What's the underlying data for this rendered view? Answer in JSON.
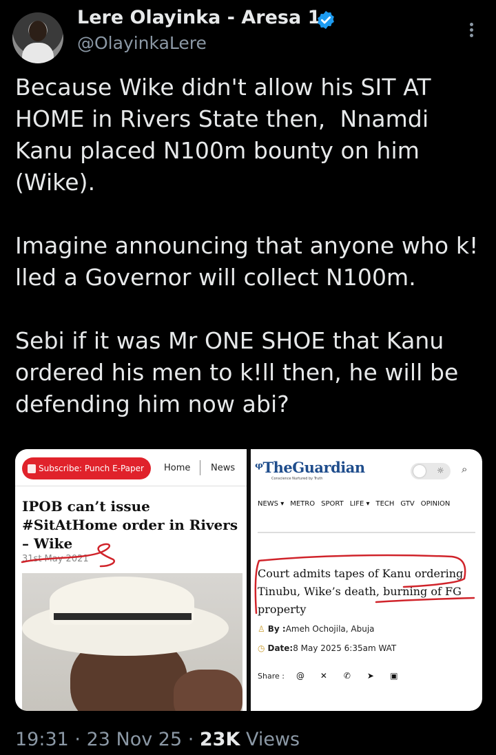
{
  "author": {
    "display_name": "Lere Olayinka - Aresa 1",
    "handle": "@OlayinkaLere",
    "verified_color": "#1d9bf0",
    "avatar_icon": "profile-photo"
  },
  "tweet": {
    "text": "Because Wike didn't allow his SIT AT\nHOME in Rivers State then,  Nnamdi\nKanu placed N100m bounty on him\n(Wike).\n\nImagine announcing that anyone who k!\nlled a Governor will collect N100m.\n\nSebi if it was Mr ONE SHOE that Kanu\nordered his men to k!ll then, he will be\ndefending him now abi?"
  },
  "media": {
    "punch": {
      "subscribe_label": "Subscribe: Punch E-Paper",
      "nav_home": "Home",
      "nav_news": "News",
      "headline": "IPOB can’t issue #SitAtHome order in Rivers – Wike",
      "date": "31st May 2021",
      "accent_color": "#e0222b"
    },
    "guardian": {
      "logo": "TheGuardian",
      "tagline": "Conscience Nurtured by Truth",
      "nav": [
        "NEWS ▾",
        "METRO",
        "SPORT",
        "LIFE ▾",
        "TECH",
        "GTV",
        "OPINION"
      ],
      "headline": "Court admits tapes of Kanu ordering Tinubu, Wike’s death, burning of FG property",
      "by_label": "By :",
      "by_value": "Ameh Ochojila, Abuja",
      "date_label": "Date:",
      "date_value": "8 May 2025 6:35am WAT",
      "share_label": "Share :",
      "share_icons": [
        "threads-icon",
        "x-icon",
        "whatsapp-icon",
        "telegram-icon",
        "linkedin-icon"
      ]
    }
  },
  "footer": {
    "time": "19:31",
    "sep1": " · ",
    "date": "23 Nov 25",
    "sep2": " · ",
    "views_count": "23K",
    "views_label": " Views"
  }
}
